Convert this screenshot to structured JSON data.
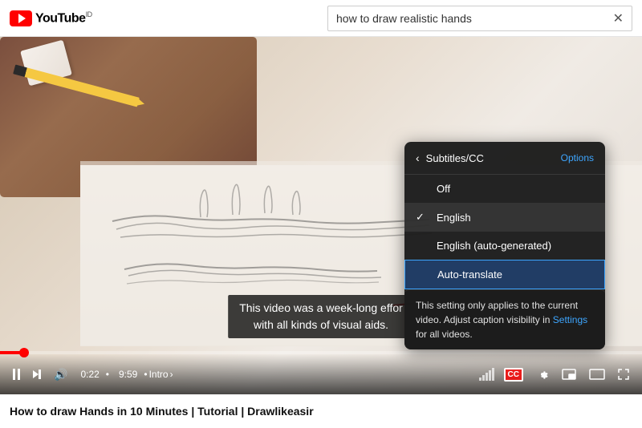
{
  "header": {
    "logo_text": "YouTube",
    "logo_superscript": "ID",
    "search_value": "how to draw realistic hands",
    "close_label": "✕"
  },
  "video": {
    "subtitle_line1": "This video was a week-long effor",
    "subtitle_line2": "with all kinds of visual aids.",
    "time_current": "0:22",
    "time_total": "9:59",
    "separator": "•",
    "chapter": "Intro",
    "chapter_arrow": "›"
  },
  "settings_panel": {
    "back_arrow": "‹",
    "title": "Subtitles/CC",
    "options_label": "Options",
    "items": [
      {
        "label": "Off",
        "selected": false
      },
      {
        "label": "English",
        "selected": true
      },
      {
        "label": "English (auto-generated)",
        "selected": false
      },
      {
        "label": "Auto-translate",
        "selected": false,
        "active": true
      }
    ],
    "tooltip": "This setting only applies to the current video. Adjust caption visibility in ",
    "tooltip_link": "Settings",
    "tooltip_end": " for all videos."
  },
  "title_bar": {
    "title": "How to draw Hands in 10 Minutes | Tutorial | Drawlikeasir"
  },
  "controls": {
    "cc_label": "CC",
    "quality_bars": [
      4,
      7,
      10,
      13,
      16
    ]
  }
}
